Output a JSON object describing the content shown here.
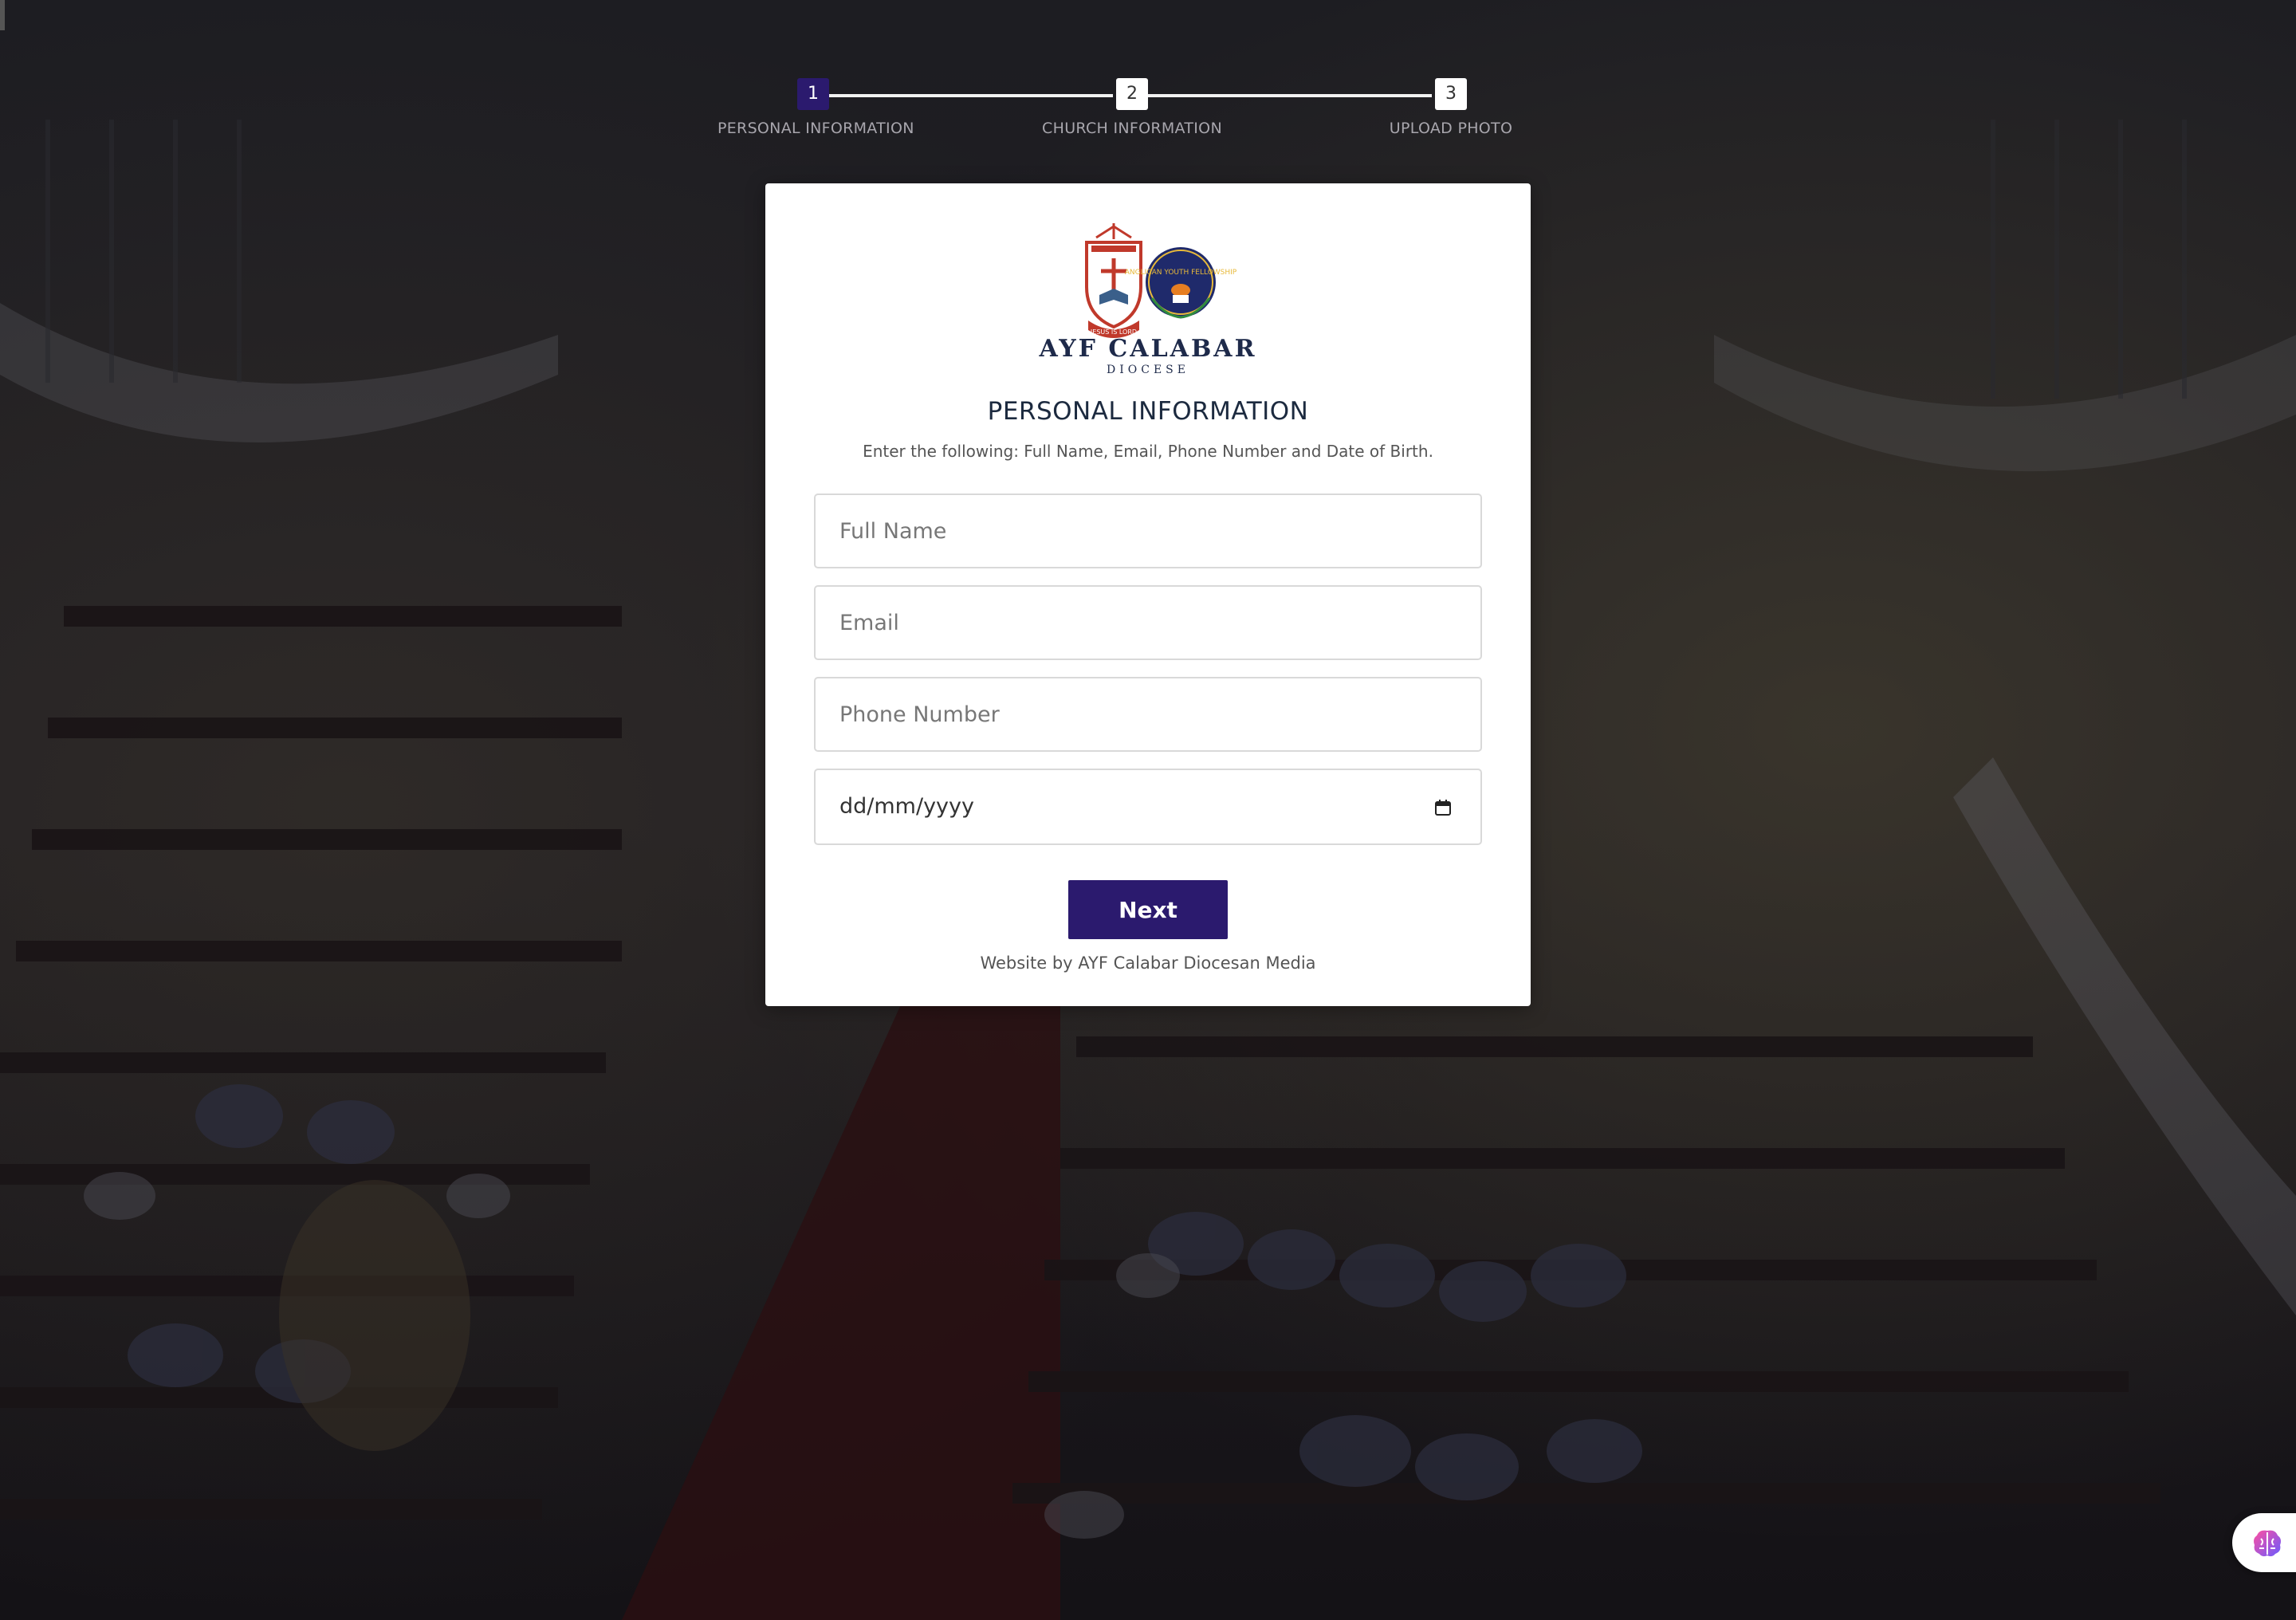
{
  "stepper": {
    "steps": [
      {
        "number": "1",
        "label": "PERSONAL INFORMATION",
        "active": true
      },
      {
        "number": "2",
        "label": "CHURCH INFORMATION",
        "active": false
      },
      {
        "number": "3",
        "label": "UPLOAD PHOTO",
        "active": false
      }
    ]
  },
  "logo": {
    "title": "AYF CALABAR",
    "subtitle": "DIOCESE",
    "crest_banner": "JESUS IS LORD",
    "badge_text": "ANGLICAN YOUTH FELLOWSHIP"
  },
  "form": {
    "title": "PERSONAL INFORMATION",
    "description": "Enter the following: Full Name, Email, Phone Number and Date of Birth.",
    "full_name_placeholder": "Full Name",
    "email_placeholder": "Email",
    "phone_placeholder": "Phone Number",
    "date_placeholder": "dd/mm/yyyy",
    "next_label": "Next"
  },
  "footer": {
    "credit": "Website by AYF Calabar Diocesan Media"
  },
  "colors": {
    "primary": "#2b1a6e",
    "card_bg": "#ffffff",
    "step_line": "#f2f2f2",
    "icon": "calendar-icon"
  }
}
